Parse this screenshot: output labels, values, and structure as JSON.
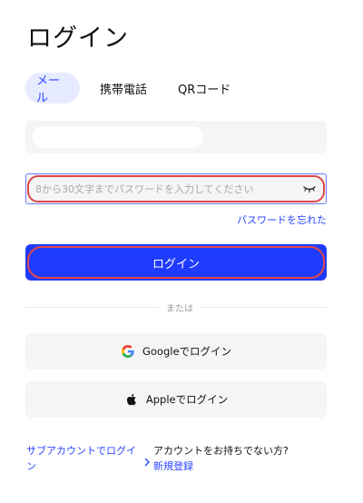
{
  "page": {
    "title": "ログイン"
  },
  "tabs": [
    {
      "label": "メール",
      "active": true
    },
    {
      "label": "携帯電話",
      "active": false
    },
    {
      "label": "QRコード",
      "active": false
    }
  ],
  "email": {
    "value": "",
    "placeholder": ""
  },
  "password": {
    "placeholder": "8から30文字までパスワードを入力してください",
    "icon": "eye-closed-icon"
  },
  "forgot_password_label": "パスワードを忘れた",
  "login_button_label": "ログイン",
  "divider_label": "または",
  "social": {
    "google_label": "Googleでログイン",
    "apple_label": "Appleでログイン"
  },
  "footer": {
    "sub_account_label": "サブアカウントでログイン",
    "no_account_label": "アカウントをお持ちでない方?",
    "register_label": "新規登録"
  },
  "colors": {
    "accent": "#1f3bff",
    "highlight_ring": "#e04848",
    "tab_active_bg": "#e7ebff"
  }
}
